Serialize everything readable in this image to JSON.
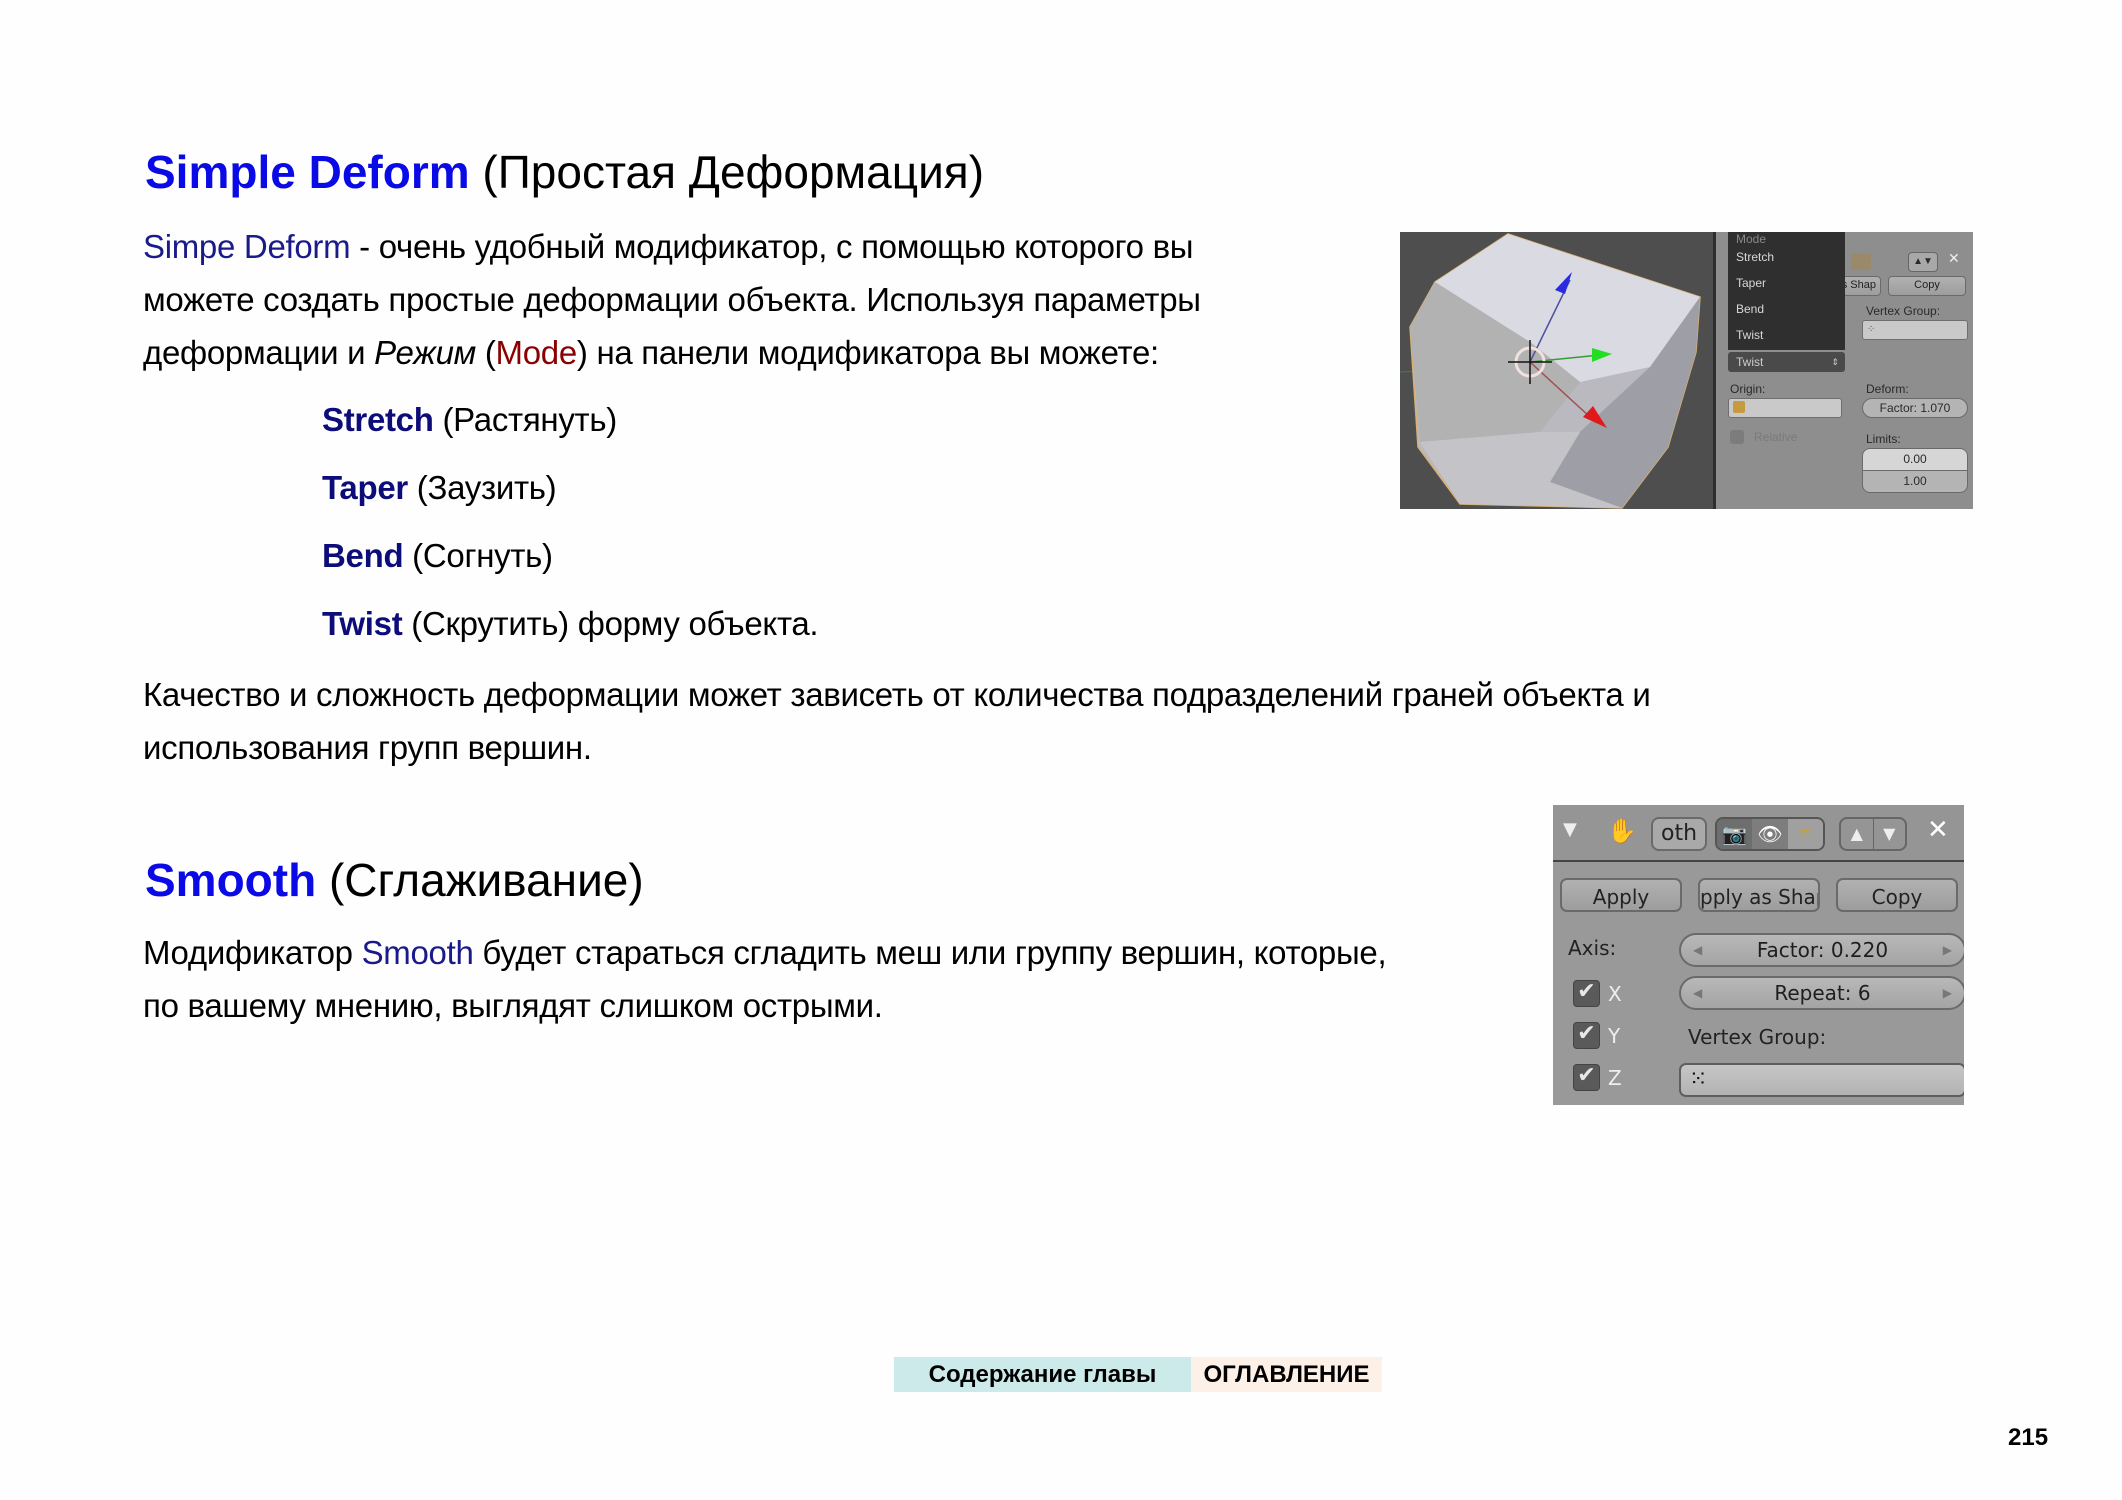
{
  "section1": {
    "title_en": "Simple Deform",
    "title_ru": "(Простая Деформация)",
    "intro": {
      "term": "Simpe Deform",
      "line1_rest": " - очень удобный модификатор, с помощью которого вы",
      "line2": "можете создать простые деформации объекта. Используя параметры",
      "line3_a": "деформации и ",
      "line3_italic": "Режим",
      "line3_b": " (",
      "line3_mode": "Mode",
      "line3_c": ") на панели модификатора вы можете:"
    },
    "modes": [
      {
        "en": "Stretch",
        "ru": " (Растянуть)"
      },
      {
        "en": "Taper",
        "ru": " (Заузить)"
      },
      {
        "en": "Bend",
        "ru": " (Согнуть)"
      },
      {
        "en": "Twist",
        "ru": " (Скрутить) форму объекта."
      }
    ],
    "note_line1": "Качество и сложность деформации может зависеть от количества подразделений граней объекта и",
    "note_line2": "использования групп вершин.",
    "screenshot": {
      "menu_title": "Mode",
      "menu_items": [
        "Stretch",
        "Taper",
        "Bend",
        "Twist"
      ],
      "selected_mode": "Twist",
      "copy_label": "Copy",
      "apply_shape_label": "s Shap",
      "vertex_group_label": "Vertex Group:",
      "origin_label": "Origin:",
      "deform_label": "Deform:",
      "factor_label": "Factor: 1.070",
      "relative_label": "Relative",
      "limits_label": "Limits:",
      "limit_min": "0.00",
      "limit_max": "1.00"
    }
  },
  "section2": {
    "title_en": "Smooth",
    "title_ru": "(Сглаживание)",
    "line1_a": "Модификатор ",
    "line1_term": "Smooth",
    "line1_b": " будет стараться сгладить меш или группу вершин, которые,",
    "line2": "по вашему мнению, выглядят слишком острыми.",
    "screenshot": {
      "name_field": "oth",
      "apply_label": "Apply",
      "apply_shape_label": "pply as Shap",
      "copy_label": "Copy",
      "axis_label": "Axis:",
      "axes": [
        {
          "label": "X",
          "checked": true
        },
        {
          "label": "Y",
          "checked": true
        },
        {
          "label": "Z",
          "checked": true
        }
      ],
      "factor_label": "Factor: 0.220",
      "repeat_label": "Repeat: 6",
      "vertex_group_label": "Vertex Group:",
      "vertex_group_value": ""
    }
  },
  "footer": {
    "chapter_contents": "Содержание главы",
    "toc": "ОГЛАВЛЕНИЕ",
    "chapter_contents_color": "#cdeaea",
    "toc_color": "#fdf0e6",
    "page_number": "215"
  }
}
